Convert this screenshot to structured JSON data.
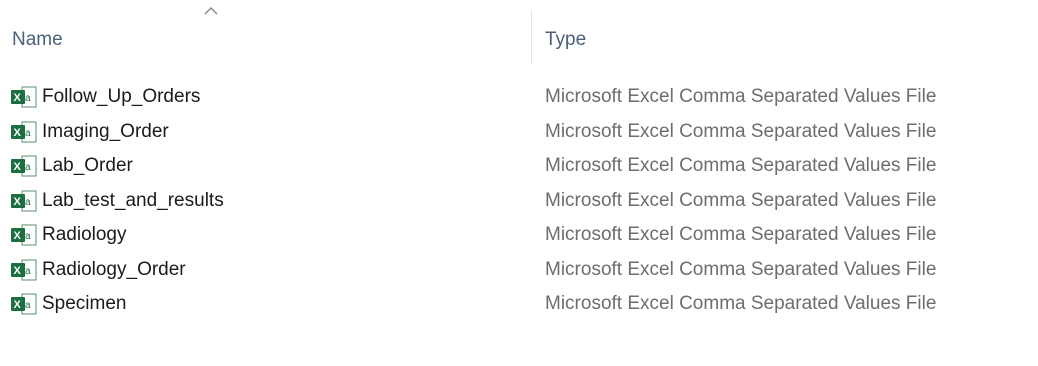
{
  "columns": {
    "name_label": "Name",
    "type_label": "Type",
    "sort_icon": "chevron-up-icon"
  },
  "files": [
    {
      "name": "Follow_Up_Orders",
      "type": "Microsoft Excel Comma Separated Values File",
      "icon": "excel-csv-file-icon"
    },
    {
      "name": "Imaging_Order",
      "type": "Microsoft Excel Comma Separated Values File",
      "icon": "excel-csv-file-icon"
    },
    {
      "name": "Lab_Order",
      "type": "Microsoft Excel Comma Separated Values File",
      "icon": "excel-csv-file-icon"
    },
    {
      "name": "Lab_test_and_results",
      "type": "Microsoft Excel Comma Separated Values File",
      "icon": "excel-csv-file-icon"
    },
    {
      "name": "Radiology",
      "type": "Microsoft Excel Comma Separated Values File",
      "icon": "excel-csv-file-icon"
    },
    {
      "name": "Radiology_Order",
      "type": "Microsoft Excel Comma Separated Values File",
      "icon": "excel-csv-file-icon"
    },
    {
      "name": "Specimen",
      "type": "Microsoft Excel Comma Separated Values File",
      "icon": "excel-csv-file-icon"
    }
  ],
  "colors": {
    "excel_green": "#1d6f42",
    "header_text": "#4c607a",
    "type_text": "#6d6d6d"
  }
}
